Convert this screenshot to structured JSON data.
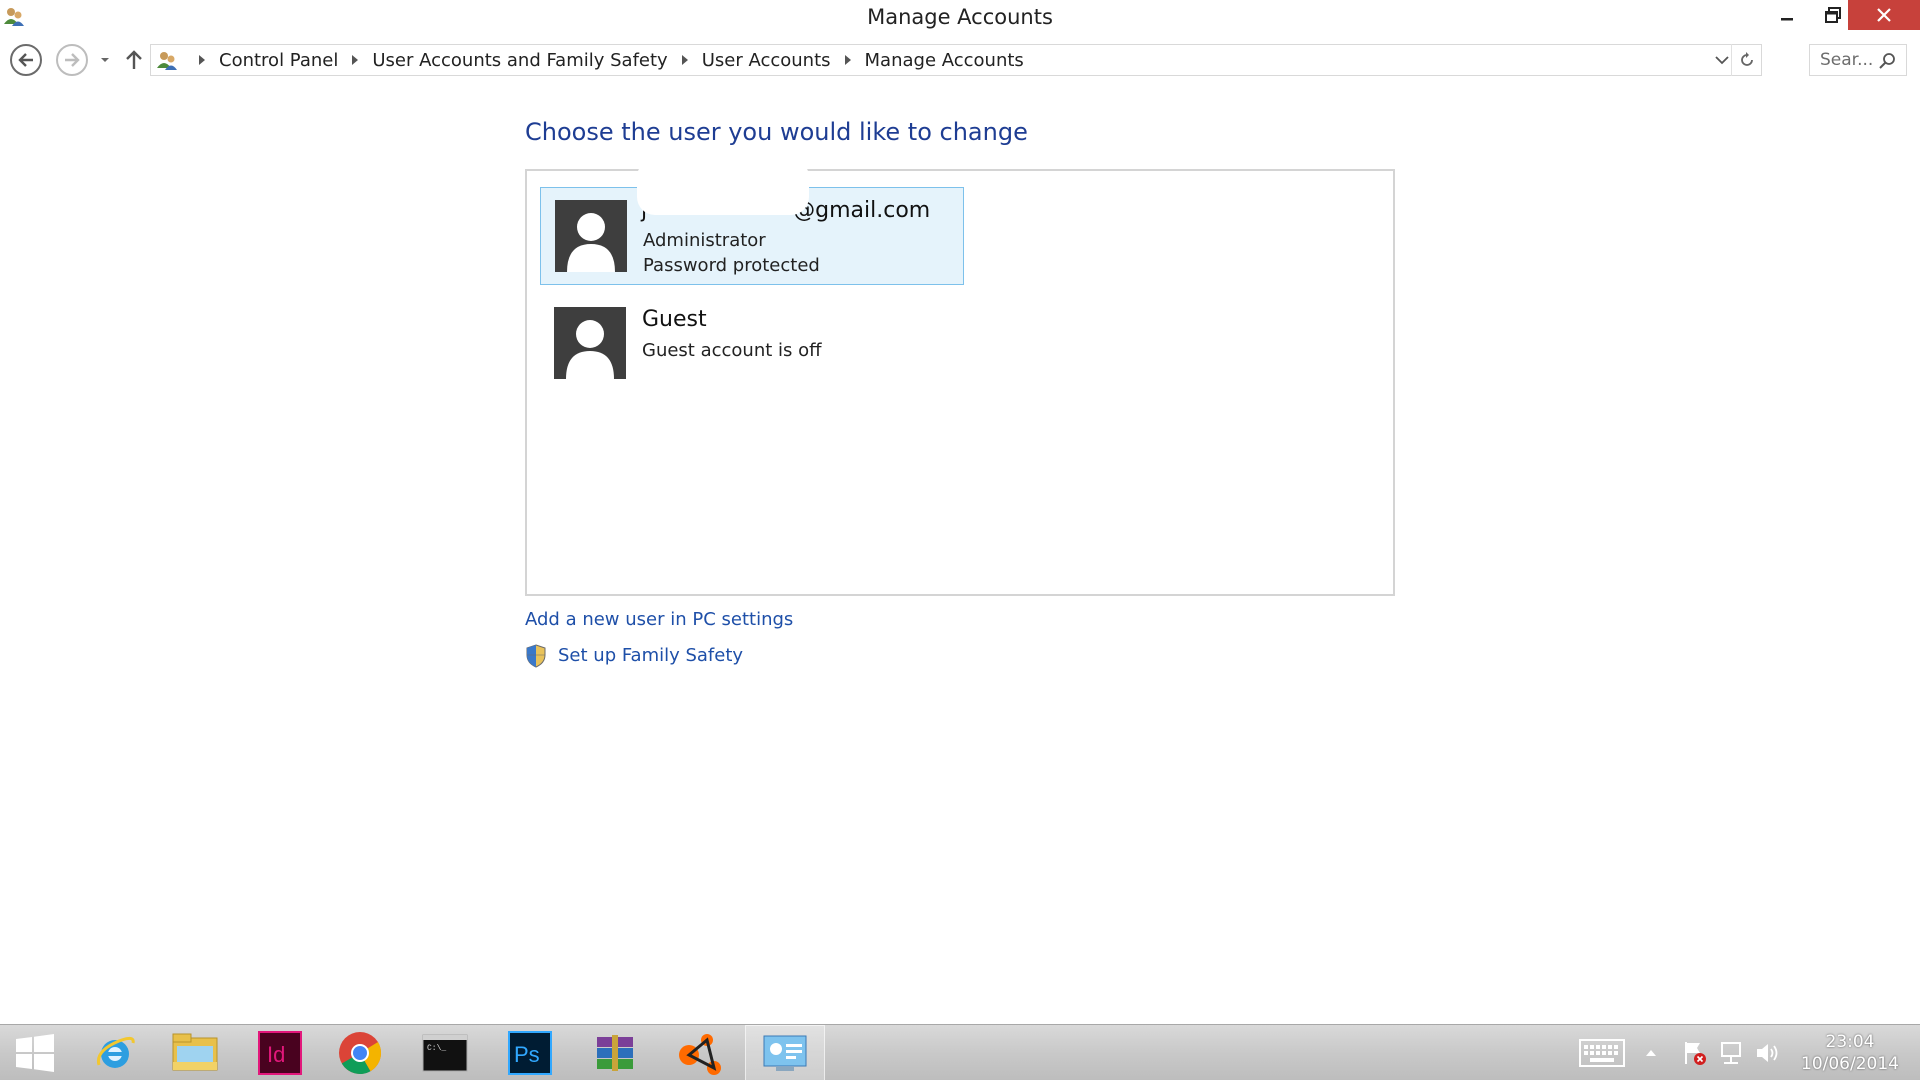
{
  "window": {
    "title": "Manage Accounts",
    "icon": "users-icon"
  },
  "navigation": {
    "breadcrumbs": [
      "Control Panel",
      "User Accounts and Family Safety",
      "User Accounts",
      "Manage Accounts"
    ],
    "search_placeholder": "Sear..."
  },
  "main": {
    "heading": "Choose the user you would like to change",
    "accounts": [
      {
        "name": "j@gmail.com",
        "name_visible_suffix": "@gmail.com",
        "role": "Administrator",
        "status": "Password protected",
        "selected": true,
        "name_partially_redacted": true
      },
      {
        "name": "Guest",
        "status": "Guest account is off",
        "selected": false
      }
    ],
    "links": {
      "add_user": "Add a new user in PC settings",
      "family_safety": "Set up Family Safety"
    }
  },
  "taskbar": {
    "apps": [
      "start",
      "internet-explorer",
      "file-explorer",
      "indesign",
      "chrome",
      "command-prompt",
      "photoshop",
      "winrar",
      "avast",
      "control-panel"
    ],
    "active_app": "control-panel",
    "clock": {
      "time": "23:04",
      "date": "10/06/2014"
    }
  },
  "colors": {
    "heading": "#1e3d93",
    "link": "#1e4fa8",
    "selected_bg": "#e5f3fb",
    "selected_border": "#7dc1eb",
    "close_button": "#c7413b"
  }
}
